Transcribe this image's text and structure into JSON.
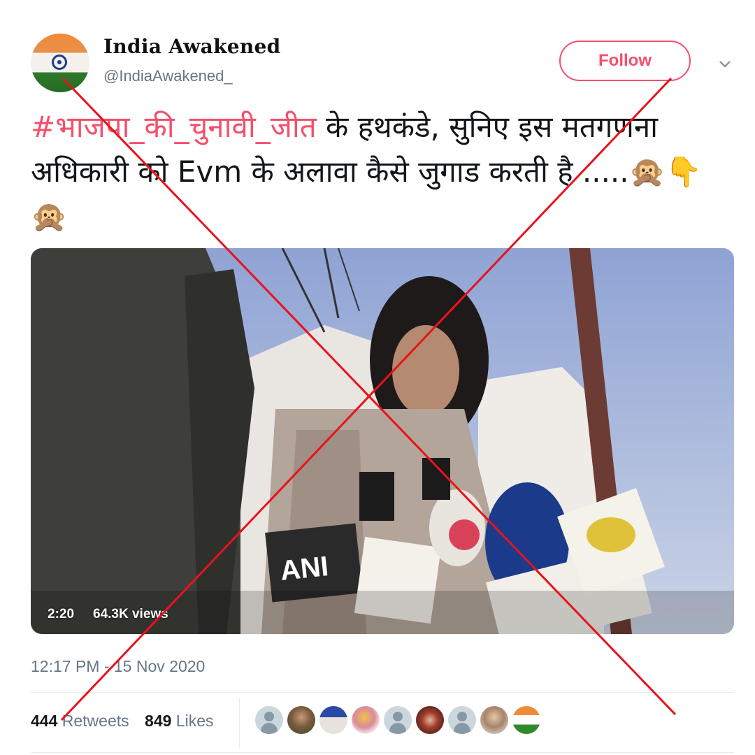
{
  "author": {
    "display_name": "India Awakened",
    "handle": "@IndiaAwakened_",
    "avatar_icon": "india-flag-avatar"
  },
  "header": {
    "follow_label": "Follow",
    "menu_icon": "chevron-down-icon",
    "accent_color": "#f4506b"
  },
  "tweet": {
    "hashtag": "#भाजपा_की_चुनावी_जीत",
    "text": " के हथकंडे, सुनिए इस मतगणना अधिकारी को Evm के अलावा कैसे जुगाड करती है .....",
    "emojis": "🙊👇🙊"
  },
  "media": {
    "duration": "2:20",
    "views": "64.3K views",
    "mic_label": "ANI"
  },
  "timestamp": "12:17 PM - 15 Nov 2020",
  "stats": {
    "retweets_count": "444",
    "retweets_label": "Retweets",
    "likes_count": "849",
    "likes_label": "Likes"
  },
  "overlay": {
    "cross_color": "#e8131b"
  }
}
